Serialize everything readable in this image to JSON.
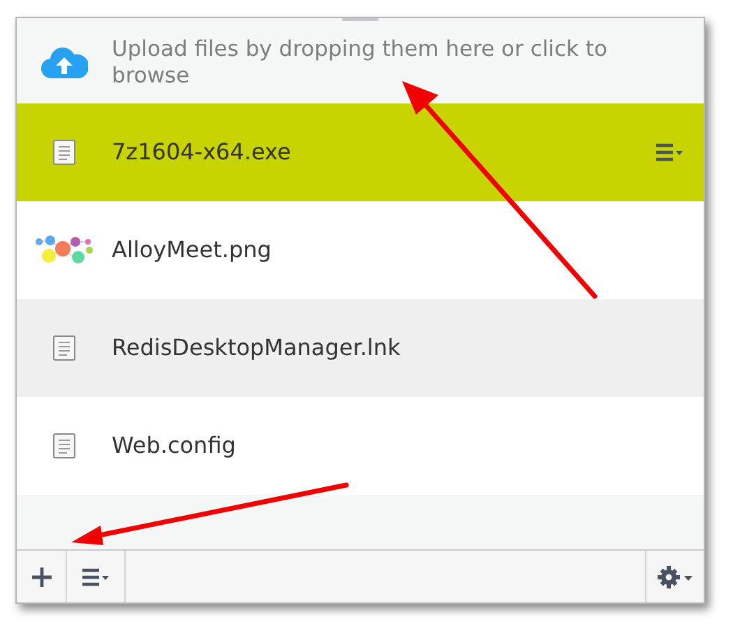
{
  "upload": {
    "text": "Upload files by dropping them here or click to browse"
  },
  "files": [
    {
      "name": "7z1604-x64.exe",
      "kind": "document",
      "selected": true,
      "hovered": false
    },
    {
      "name": "AlloyMeet.png",
      "kind": "image",
      "selected": false,
      "hovered": false
    },
    {
      "name": "RedisDesktopManager.lnk",
      "kind": "document",
      "selected": false,
      "hovered": true
    },
    {
      "name": "Web.config",
      "kind": "document",
      "selected": false,
      "hovered": false
    }
  ]
}
